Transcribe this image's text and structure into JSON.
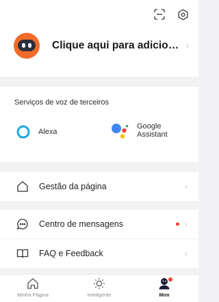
{
  "header": {
    "profile_title": "Clique aqui para adiciona...",
    "icons": [
      "scan-icon",
      "settings-icon"
    ]
  },
  "voice": {
    "section_title": "Serviços de voz de terceiros",
    "alexa_label": "Alexa",
    "google_label_line1": "Google",
    "google_label_line2": "Assistant"
  },
  "menu": {
    "page_management": "Gestão da página",
    "message_center": "Centro de mensagens",
    "faq": "FAQ e Feedback"
  },
  "tabs": {
    "home": "Minha Página",
    "smart": "Inteligente",
    "me": "Mim"
  },
  "colors": {
    "accent_red": "#f0412e",
    "avatar_orange": "#f06b2a",
    "alexa_blue": "#1ea7e1"
  }
}
